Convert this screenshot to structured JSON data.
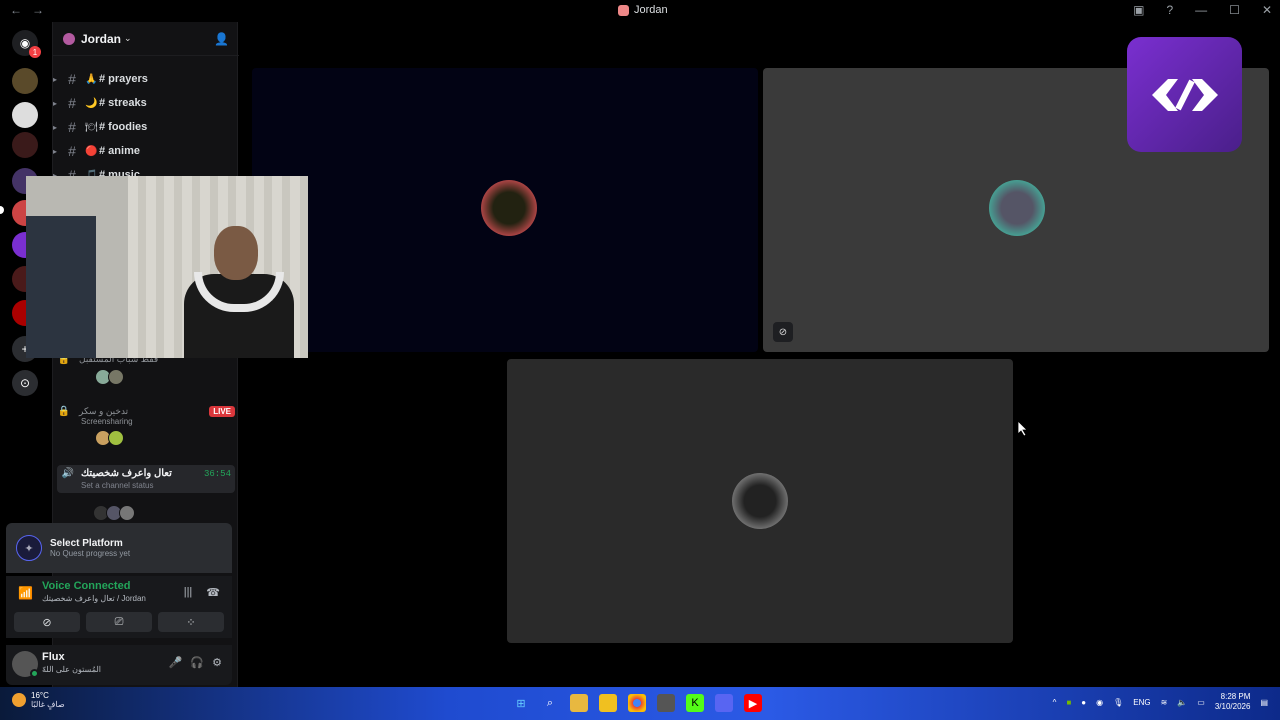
{
  "window": {
    "title": "Jordan"
  },
  "guild": {
    "name": "Jordan"
  },
  "channels": [
    {
      "emoji": "🙏",
      "name": "# prayers"
    },
    {
      "emoji": "🌙",
      "name": "# streaks"
    },
    {
      "emoji": "🍽",
      "name": "# foodies"
    },
    {
      "emoji": "🔴",
      "name": "# anime"
    },
    {
      "emoji": "🎵",
      "name": "# music"
    }
  ],
  "voice_channels": [
    {
      "name": "فقط شباب المستقبل",
      "live": false
    },
    {
      "name": "تدخين و سكر",
      "sub": "Screensharing",
      "live": true,
      "live_label": "LIVE"
    },
    {
      "name": "تعال واعرف شخصيتك",
      "time": "36:54",
      "status": "Set a channel status"
    }
  ],
  "quest": {
    "title": "Select Platform",
    "subtitle": "No Quest progress yet"
  },
  "voice_panel": {
    "title": "Voice Connected",
    "subtitle": "تعال واعرف شخصيتك / Jordan"
  },
  "user": {
    "name": "Flux",
    "status": "المُستون على اللهّ"
  },
  "taskbar": {
    "weather_temp": "16°C",
    "weather_desc": "صافٍ غالبًا",
    "lang": "ENG",
    "time": "8:28 PM",
    "date": "3/10/2026"
  },
  "colors": {
    "accent_green": "#23a55a",
    "live_red": "#da373c",
    "blurple": "#5865f2"
  }
}
